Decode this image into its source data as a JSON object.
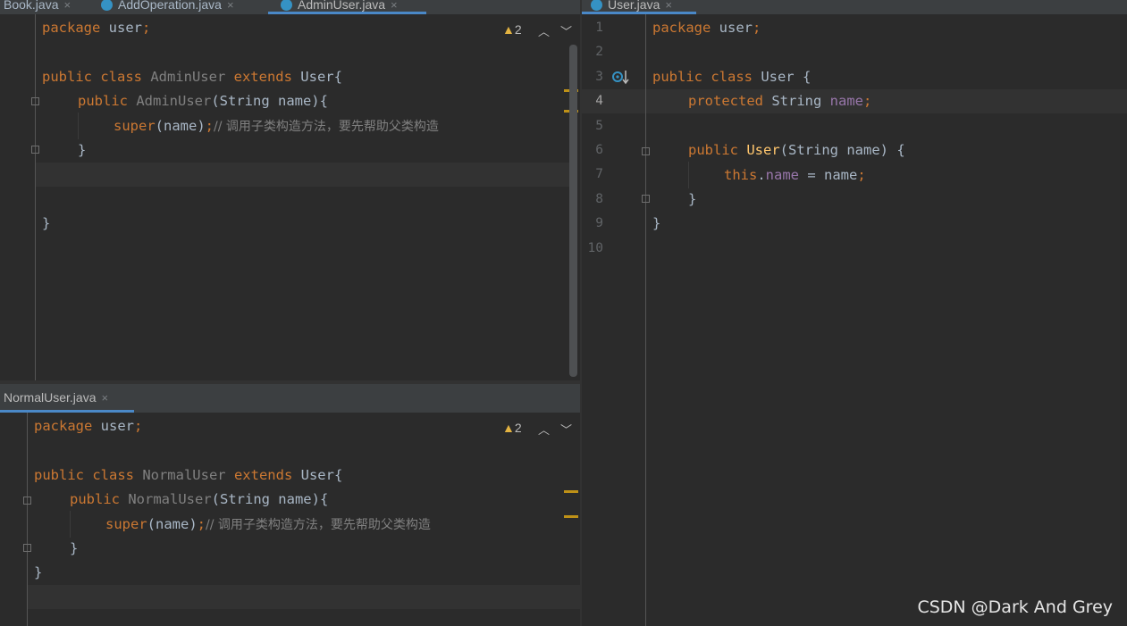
{
  "colors": {
    "background": "#2b2b2b",
    "keyword": "#cc7832",
    "method": "#ffc66d",
    "field": "#9876aa",
    "comment": "#808080",
    "text": "#a9b7c6",
    "tab_accent": "#4a88c7",
    "warning": "#e3b341"
  },
  "left_top_tabs": [
    {
      "label": "Book.java",
      "close": "×"
    },
    {
      "label": "AddOperation.java",
      "close": "×"
    },
    {
      "label": "AdminUser.java",
      "close": "×",
      "active": true
    }
  ],
  "right_tabs": [
    {
      "label": "User.java",
      "close": "×",
      "active": true
    }
  ],
  "bottom_tabs": [
    {
      "label": "NormalUser.java",
      "close": "×",
      "active": true
    }
  ],
  "admin_editor": {
    "warning_count": "2",
    "lines": {
      "l1_kw": "package",
      "l1_rest": " user",
      "l1_semi": ";",
      "l3_kw": "public class",
      "l3_cls": " AdminUser",
      "l3_ext": " extends",
      "l3_rest": " User{",
      "l4_kw": "public",
      "l4_ctor": " AdminUser",
      "l4_rest": "(String name){",
      "l5_kw": "super",
      "l5_rest": "(name)",
      "l5_semi": ";",
      "l5_comment": "// 调用子类构造方法，要先帮助父类构造",
      "l6": "}",
      "l9": "}"
    }
  },
  "normal_editor": {
    "warning_count": "2",
    "lines": {
      "l1_kw": "package",
      "l1_rest": " user",
      "l1_semi": ";",
      "l3_kw": "public class",
      "l3_cls": " NormalUser",
      "l3_ext": " extends",
      "l3_rest": " User{",
      "l4_kw": "public",
      "l4_ctor": " NormalUser",
      "l4_rest": "(String name){",
      "l5_kw": "super",
      "l5_rest": "(name)",
      "l5_semi": ";",
      "l5_comment": "// 调用子类构造方法，要先帮助父类构造",
      "l6": "}",
      "l7": "}"
    }
  },
  "user_editor": {
    "line_numbers": [
      "1",
      "2",
      "3",
      "4",
      "5",
      "6",
      "7",
      "8",
      "9",
      "10"
    ],
    "lines": {
      "l1_kw": "package",
      "l1_rest": " user",
      "l1_semi": ";",
      "l3_kw": "public class",
      "l3_rest": " User {",
      "l4_kw": "protected",
      "l4_type": " String",
      "l4_field": " name",
      "l4_semi": ";",
      "l6_kw": "public",
      "l6_ctor": " User",
      "l6_rest": "(String name) {",
      "l7_kw": "this",
      "l7_dot": ".",
      "l7_field": "name",
      "l7_rest": " = name",
      "l7_semi": ";",
      "l8": "}",
      "l9": "}"
    }
  },
  "watermark": "CSDN @Dark And Grey"
}
